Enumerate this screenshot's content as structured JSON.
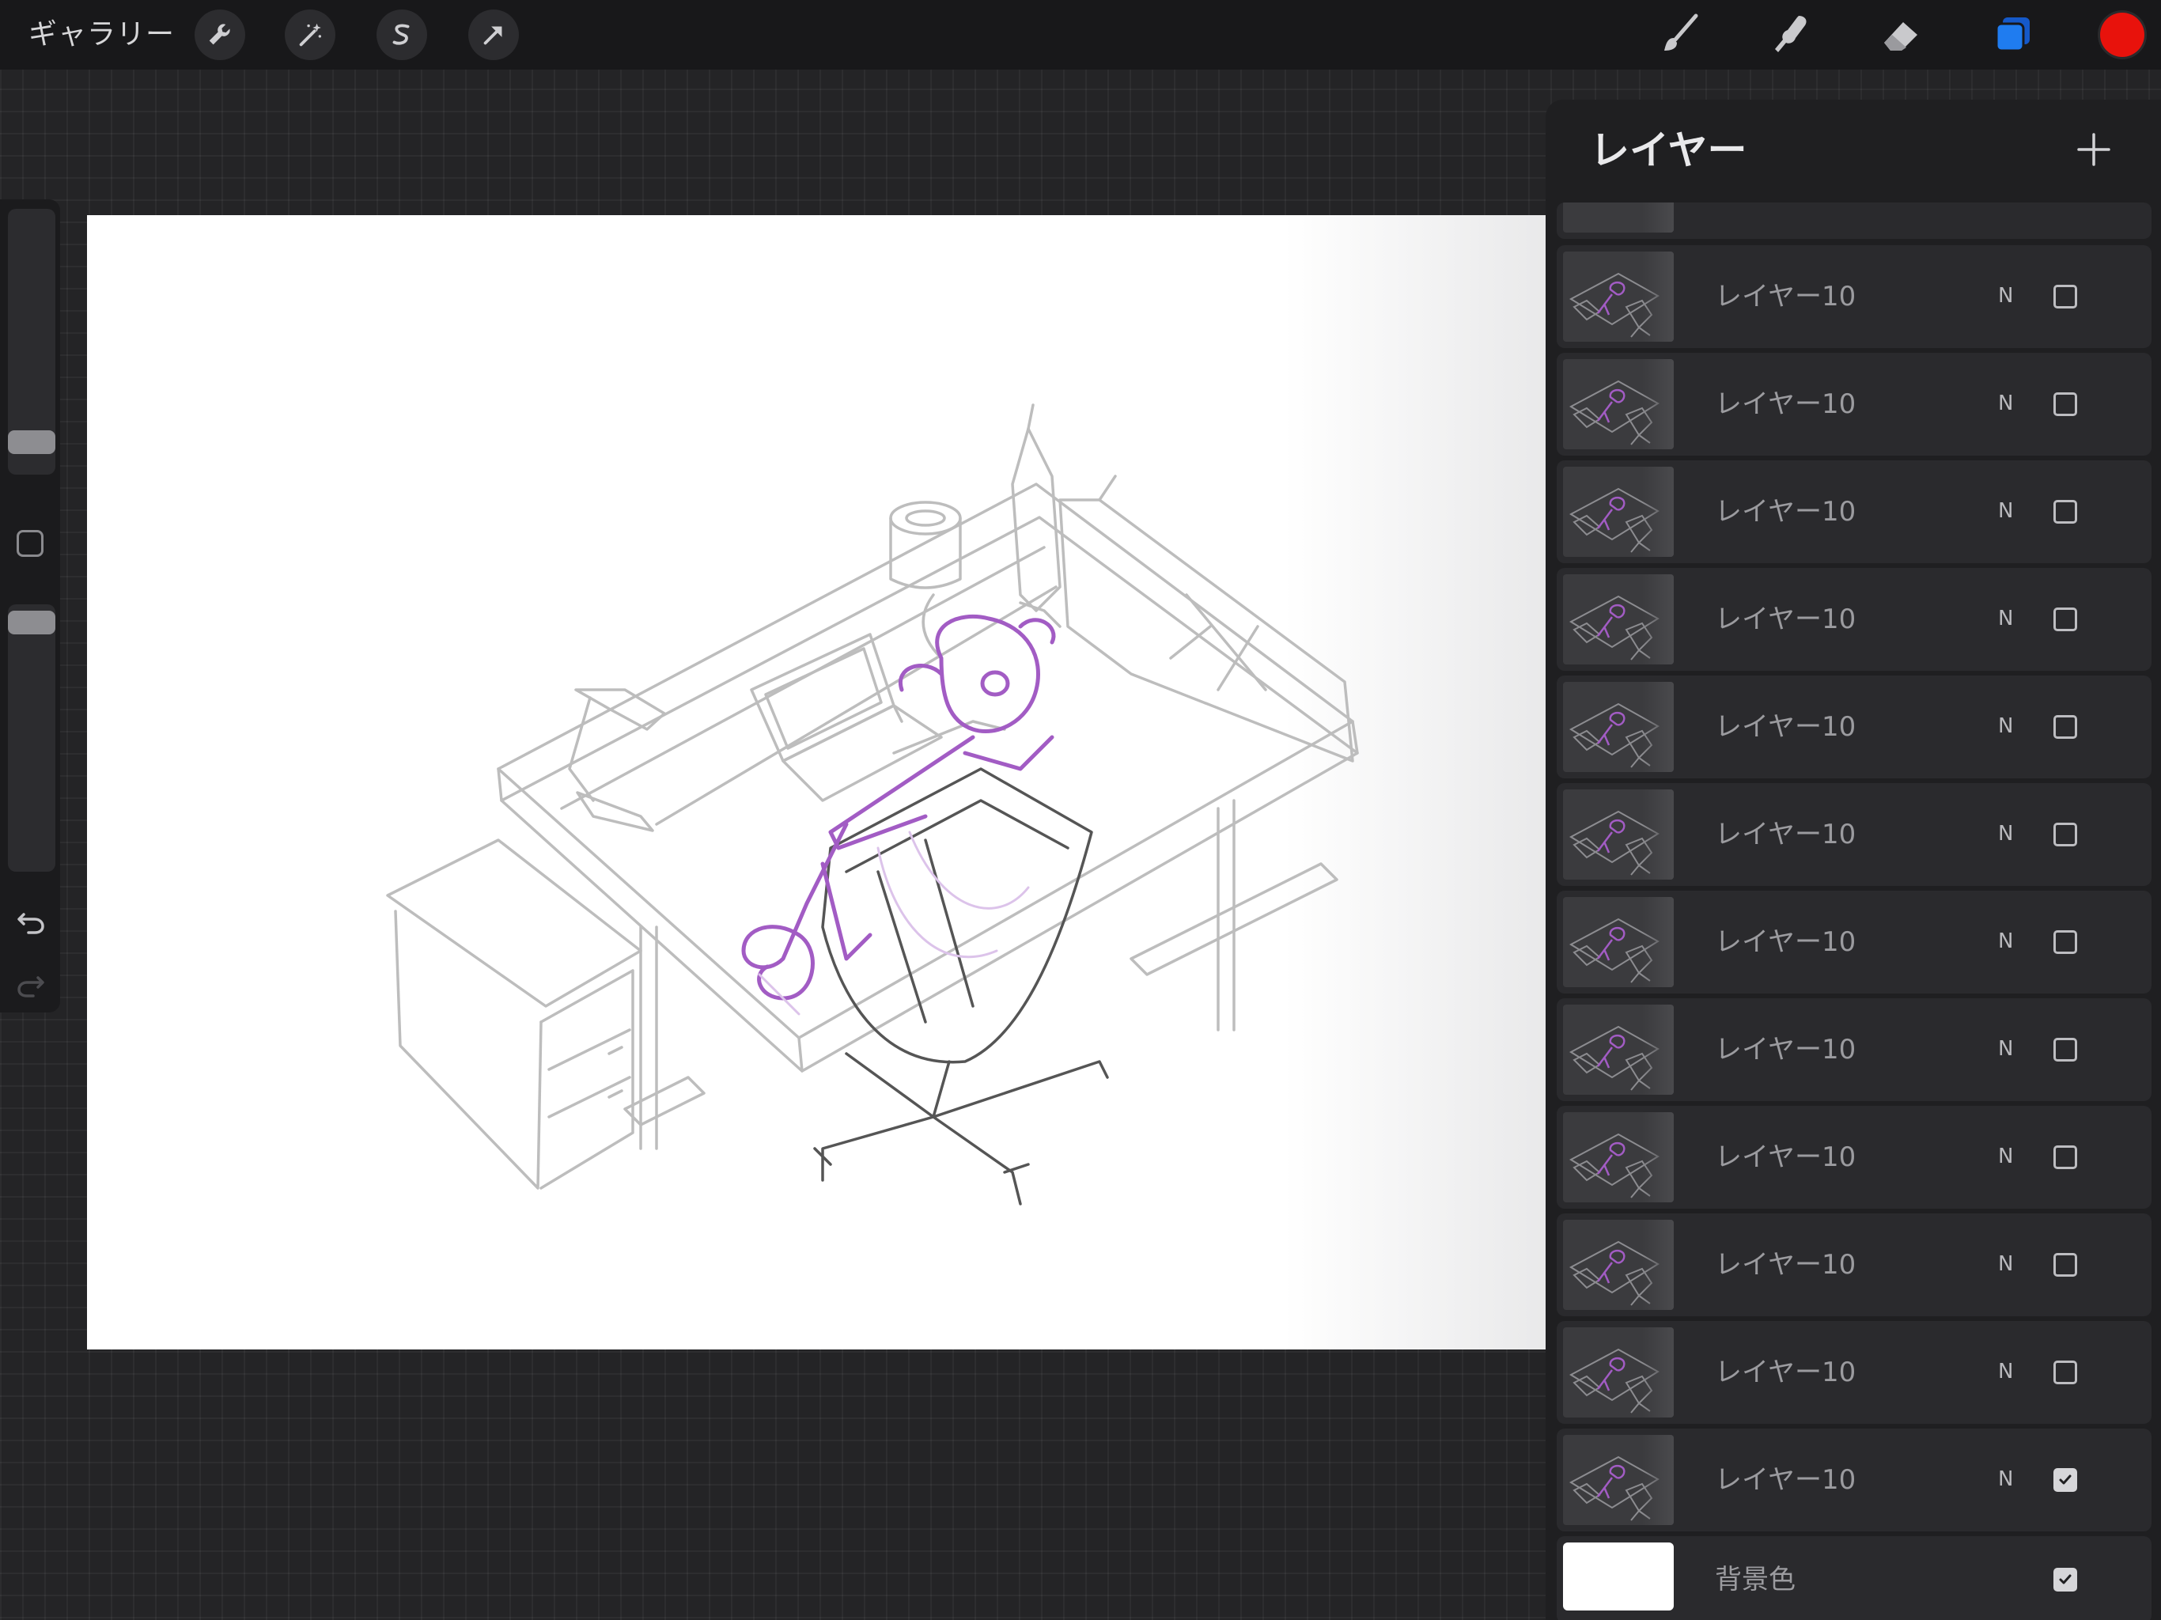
{
  "topbar": {
    "gallery_label": "ギャラリー",
    "left_tools": [
      {
        "name": "wrench-icon"
      },
      {
        "name": "magic-wand-icon"
      },
      {
        "name": "selection-s-icon"
      },
      {
        "name": "transform-arrow-icon"
      }
    ],
    "right_tools": [
      {
        "name": "brush-icon"
      },
      {
        "name": "smudge-icon"
      },
      {
        "name": "eraser-icon"
      },
      {
        "name": "layers-icon"
      }
    ],
    "current_color": "#e8120c",
    "accent_color": "#1f7cf0"
  },
  "sidebar": {
    "brush_size_fraction": 0.82,
    "opacity_fraction": 0.02,
    "icons": [
      "modify-square-icon",
      "undo-icon",
      "redo-icon"
    ]
  },
  "layers_panel": {
    "title": "レイヤー",
    "add_icon": "plus-icon",
    "layers": [
      {
        "name": "レイヤー10",
        "blend": "N",
        "visible": false
      },
      {
        "name": "レイヤー10",
        "blend": "N",
        "visible": false
      },
      {
        "name": "レイヤー10",
        "blend": "N",
        "visible": false
      },
      {
        "name": "レイヤー10",
        "blend": "N",
        "visible": false
      },
      {
        "name": "レイヤー10",
        "blend": "N",
        "visible": false
      },
      {
        "name": "レイヤー10",
        "blend": "N",
        "visible": false
      },
      {
        "name": "レイヤー10",
        "blend": "N",
        "visible": false
      },
      {
        "name": "レイヤー10",
        "blend": "N",
        "visible": false
      },
      {
        "name": "レイヤー10",
        "blend": "N",
        "visible": false
      },
      {
        "name": "レイヤー10",
        "blend": "N",
        "visible": false
      },
      {
        "name": "レイヤー10",
        "blend": "N",
        "visible": false
      },
      {
        "name": "レイヤー10",
        "blend": "N",
        "visible": true
      }
    ],
    "background": {
      "name": "背景色",
      "visible": true,
      "color": "#ffffff"
    }
  },
  "canvas": {
    "sketch_colors": {
      "furniture": "#bdbdbd",
      "chair": "#555555",
      "figure": "#a25cc4"
    }
  }
}
